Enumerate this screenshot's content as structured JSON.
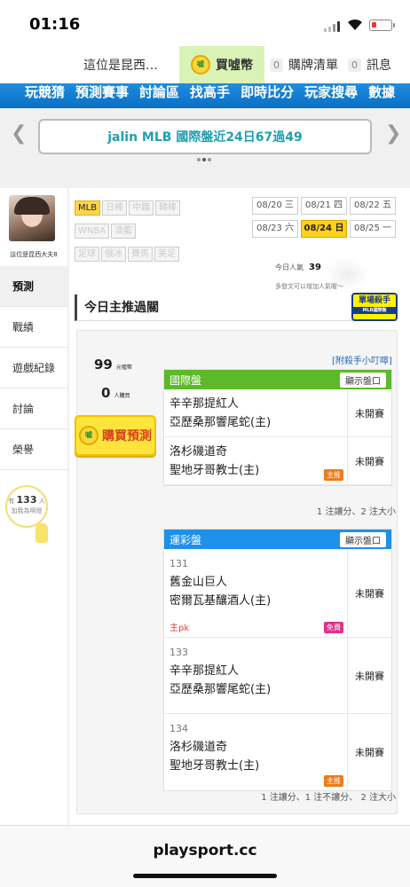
{
  "status": {
    "time": "01:16"
  },
  "topnav": {
    "nickname": "這位是昆西…",
    "buy_label": "買噓幣",
    "coin_text": "噓",
    "cart_count": "0",
    "cart_label": "購牌清單",
    "msg_count": "0",
    "msg_label": "訊息"
  },
  "mainnav": [
    "玩競猜",
    "預測賽事",
    "討論區",
    "找高手",
    "即時比分",
    "玩家搜尋",
    "數據"
  ],
  "banner": {
    "text": "jalin MLB 國際盤近24日67過49"
  },
  "user": {
    "name": "這位是昆西大夫8"
  },
  "menu": [
    "預測",
    "戰績",
    "遊戲紀錄",
    "討論",
    "榮譽"
  ],
  "fans": {
    "prefix": "有",
    "count": "133",
    "suffix": "人",
    "line2": "加我為明燈"
  },
  "sports": [
    "MLB",
    "日棒",
    "中職",
    "韓棒",
    "WNBA",
    "澳籃",
    "足球",
    "俄冰",
    "賽馬",
    "美足"
  ],
  "dates": [
    "08/20 三",
    "08/21 四",
    "08/22 五",
    "08/23 六",
    "08/24 日",
    "08/25 一"
  ],
  "popularity": {
    "label": "今日人氣",
    "value": "39",
    "hint": "多發文可以增加人氣喔～"
  },
  "section": {
    "title": "今日主推過關",
    "badge": "單場殺手",
    "badge_sub": "MLB國際盤"
  },
  "stats": {
    "price": "99",
    "price_unit": "元噓幣",
    "buyers": "0",
    "buyers_unit": "人購買",
    "buy_btn": "購買預測",
    "tip": "[附殺手小叮嚀]"
  },
  "intl": {
    "title": "國際盤",
    "btn": "顯示盤口",
    "color": "#5cba2a",
    "games": [
      {
        "away": "辛辛那提紅人",
        "home": "亞歷桑那響尾蛇(主)",
        "status": "未開賽",
        "tag": ""
      },
      {
        "away": "洛杉磯道奇",
        "home": "聖地牙哥教士(主)",
        "status": "未開賽",
        "tag": "主推"
      }
    ],
    "note": "1 注讓分、2 注大小"
  },
  "lottery": {
    "title": "運彩盤",
    "btn": "顯示盤口",
    "color": "#1e90e8",
    "games": [
      {
        "num": "131",
        "away": "舊金山巨人",
        "home": "密爾瓦基釀酒人(主)",
        "status": "未開賽",
        "tag": "免費",
        "pk": "主pk"
      },
      {
        "num": "133",
        "away": "辛辛那提紅人",
        "home": "亞歷桑那響尾蛇(主)",
        "status": "未開賽",
        "tag": "",
        "pk": ""
      },
      {
        "num": "134",
        "away": "洛杉磯道奇",
        "home": "聖地牙哥教士(主)",
        "status": "未開賽",
        "tag": "主推",
        "pk": ""
      }
    ],
    "note": "1 注讓分、1 注不讓分、 2 注大小"
  },
  "footer": {
    "url": "playsport.cc"
  }
}
